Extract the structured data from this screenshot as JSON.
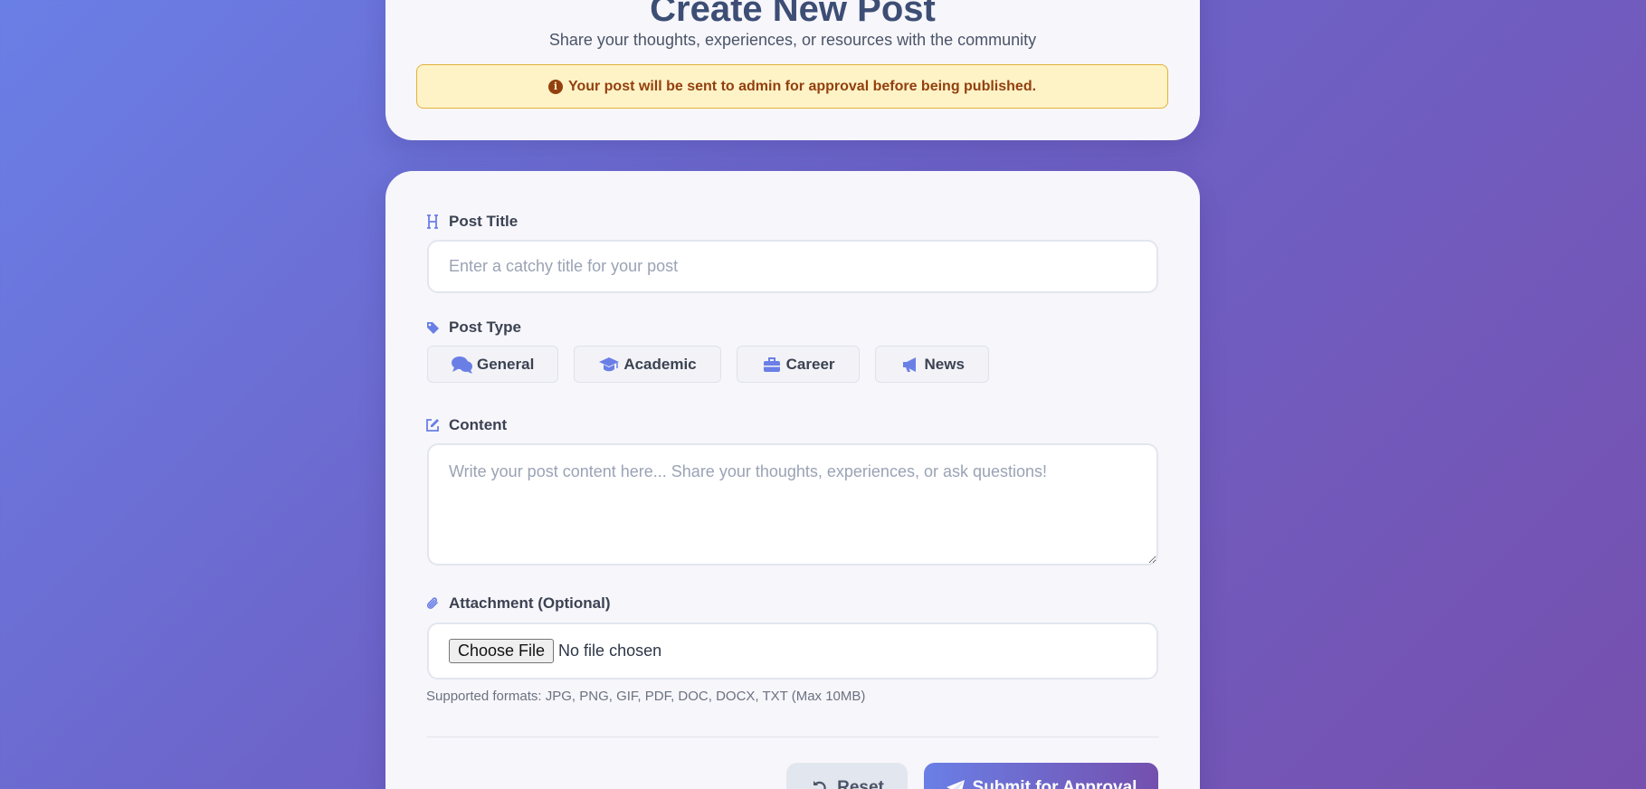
{
  "header": {
    "title": "Create New Post",
    "subtitle": "Share your thoughts, experiences, or resources with the community",
    "notice": "Your post will be sent to admin for approval before being published."
  },
  "form": {
    "title_field": {
      "label": "Post Title",
      "placeholder": "Enter a catchy title for your post",
      "value": ""
    },
    "type_field": {
      "label": "Post Type",
      "options": [
        {
          "label": "General",
          "icon": "comments-icon"
        },
        {
          "label": "Academic",
          "icon": "graduation-cap-icon"
        },
        {
          "label": "Career",
          "icon": "briefcase-icon"
        },
        {
          "label": "News",
          "icon": "megaphone-icon"
        }
      ]
    },
    "content_field": {
      "label": "Content",
      "placeholder": "Write your post content here... Share your thoughts, experiences, or ask questions!",
      "value": ""
    },
    "attachment_field": {
      "label": "Attachment (Optional)",
      "choose_label": "Choose File",
      "status": "No file chosen",
      "formats": "Supported formats: JPG, PNG, GIF, PDF, DOC, DOCX, TXT (Max 10MB)"
    },
    "actions": {
      "reset_label": "Reset",
      "submit_label": "Submit for Approval"
    }
  },
  "colors": {
    "accent": "#6a7fe6",
    "notice_bg": "#fef3c7",
    "notice_text": "#92400e"
  }
}
